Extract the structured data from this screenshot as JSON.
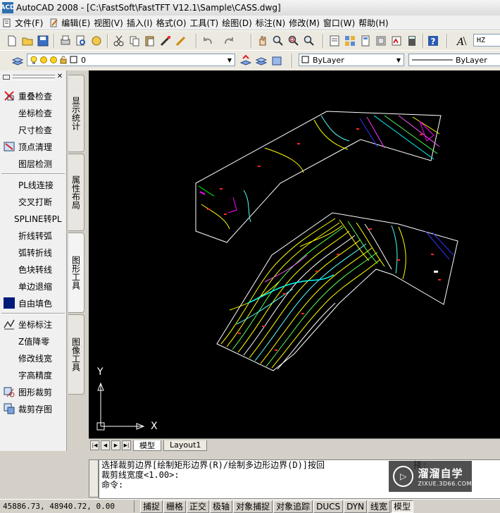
{
  "window": {
    "title": "AutoCAD 2008 - [C:\\FastSoft\\FastTFT V12.1\\Sample\\CASS.dwg]",
    "app_icon_text": "ACD"
  },
  "menu": [
    {
      "label": "文件(F)"
    },
    {
      "label": "编辑(E)"
    },
    {
      "label": "视图(V)"
    },
    {
      "label": "插入(I)"
    },
    {
      "label": "格式(O)"
    },
    {
      "label": "工具(T)"
    },
    {
      "label": "绘图(D)"
    },
    {
      "label": "标注(N)"
    },
    {
      "label": "修改(M)"
    },
    {
      "label": "窗口(W)"
    },
    {
      "label": "帮助(H)"
    }
  ],
  "toolbar": {
    "text_style_value": "HZ"
  },
  "layers": {
    "current_layer": "0",
    "color": "ByLayer",
    "linetype": "ByLayer"
  },
  "left_panel": {
    "items": [
      {
        "label": "重叠检查",
        "icon": "overlap-check-icon"
      },
      {
        "label": "坐标检查",
        "icon": ""
      },
      {
        "label": "尺寸检查",
        "icon": ""
      },
      {
        "label": "顶点清理",
        "icon": "vertex-clean-icon"
      },
      {
        "label": "图层检测",
        "icon": ""
      },
      {
        "label": "PL线连接",
        "icon": ""
      },
      {
        "label": "交叉打断",
        "icon": ""
      },
      {
        "label": "SPLINE转PL",
        "icon": ""
      },
      {
        "label": "折线转弧",
        "icon": ""
      },
      {
        "label": "弧转折线",
        "icon": ""
      },
      {
        "label": "色块转线",
        "icon": ""
      },
      {
        "label": "单边退缩",
        "icon": ""
      },
      {
        "label": "自由填色",
        "icon": "fill-color-icon"
      },
      {
        "label": "坐标标注",
        "icon": "coord-label-icon"
      },
      {
        "label": "Z值降零",
        "icon": ""
      },
      {
        "label": "修改线宽",
        "icon": ""
      },
      {
        "label": "字高精度",
        "icon": ""
      },
      {
        "label": "图形裁剪",
        "icon": "clip-icon"
      },
      {
        "label": "裁剪存图",
        "icon": "clip-save-icon"
      }
    ]
  },
  "vertical_tabs": [
    {
      "label": "显示统计"
    },
    {
      "label": "属性布局"
    },
    {
      "label": "图形工具"
    },
    {
      "label": "图像工具"
    }
  ],
  "drawing": {
    "background": "#000000",
    "ucs_x_label": "X",
    "ucs_y_label": "Y"
  },
  "layout_tabs": [
    {
      "label": "模型",
      "active": true
    },
    {
      "label": "Layout1",
      "active": false
    }
  ],
  "command": {
    "line1": "选择裁剪边界[绘制矩形边界(R)/绘制多边形边界(D)]按回",
    "line1_tail": "择:",
    "line2": " 裁剪线宽度<1.00>:",
    "prompt": "命令:"
  },
  "watermark": {
    "title": "溜溜自学",
    "url": "ZIXUE.3D66.COM"
  },
  "status": {
    "coordinates": "45886.73, 48940.72, 0.00",
    "buttons": [
      {
        "label": "捕捉",
        "pressed": false
      },
      {
        "label": "栅格",
        "pressed": false
      },
      {
        "label": "正交",
        "pressed": false
      },
      {
        "label": "极轴",
        "pressed": false
      },
      {
        "label": "对象捕捉",
        "pressed": false
      },
      {
        "label": "对象追踪",
        "pressed": false
      },
      {
        "label": "DUCS",
        "pressed": false
      },
      {
        "label": "DYN",
        "pressed": false
      },
      {
        "label": "线宽",
        "pressed": false
      },
      {
        "label": "模型",
        "pressed": true
      }
    ]
  }
}
